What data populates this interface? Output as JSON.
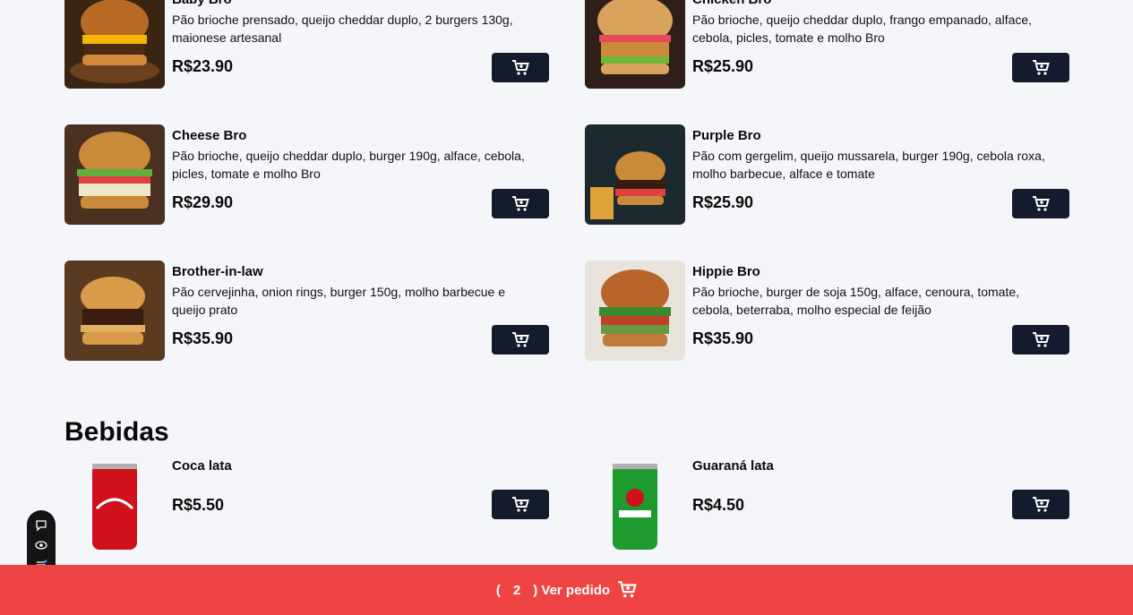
{
  "colors": {
    "button_dark": "#141b2d",
    "footer_red": "#ef4444",
    "background": "#f4f6f9"
  },
  "burgers": [
    {
      "name": "Baby Bro",
      "desc": "Pão brioche prensado, queijo cheddar duplo, 2 burgers 130g, maionese artesanal",
      "price": "R$23.90"
    },
    {
      "name": "Chicken Bro",
      "desc": "Pão brioche, queijo cheddar duplo, frango empanado, alface, cebola, picles, tomate e molho Bro",
      "price": "R$25.90"
    },
    {
      "name": "Cheese Bro",
      "desc": "Pão brioche, queijo cheddar duplo, burger 190g, alface, cebola, picles, tomate e molho Bro",
      "price": "R$29.90"
    },
    {
      "name": "Purple Bro",
      "desc": "Pão com gergelim, queijo mussarela, burger 190g, cebola roxa, molho barbecue, alface e tomate",
      "price": "R$25.90"
    },
    {
      "name": "Brother-in-law",
      "desc": "Pão cervejinha, onion rings, burger 150g, molho barbecue e queijo prato",
      "price": "R$35.90"
    },
    {
      "name": "Hippie Bro",
      "desc": "Pão brioche, burger de soja 150g, alface, cenoura, tomate, cebola, beterraba, molho especial de feijão",
      "price": "R$35.90"
    }
  ],
  "drinks_section_title": "Bebidas",
  "drinks": [
    {
      "name": "Coca lata",
      "price": "R$5.50"
    },
    {
      "name": "Guaraná lata",
      "price": "R$4.50"
    }
  ],
  "footer": {
    "open_paren": "(",
    "count": "2",
    "label": ") Ver pedido"
  },
  "icons": {
    "cart": "cart-icon",
    "chat": "chat-icon",
    "eye": "eye-icon",
    "list": "list-icon"
  }
}
